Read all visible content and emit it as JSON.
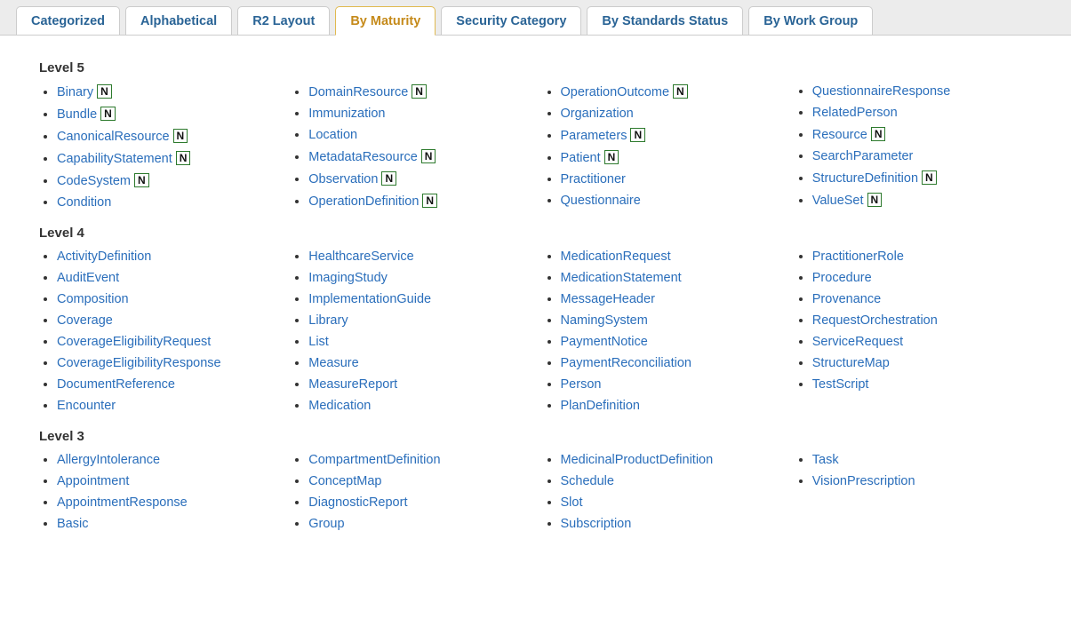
{
  "tabs": [
    {
      "label": "Categorized",
      "active": false
    },
    {
      "label": "Alphabetical",
      "active": false
    },
    {
      "label": "R2 Layout",
      "active": false
    },
    {
      "label": "By Maturity",
      "active": true
    },
    {
      "label": "Security Category",
      "active": false
    },
    {
      "label": "By Standards Status",
      "active": false
    },
    {
      "label": "By Work Group",
      "active": false
    }
  ],
  "n_badge": "N",
  "levels": [
    {
      "heading": "Level 5",
      "columns": [
        [
          {
            "label": "Binary",
            "n": true
          },
          {
            "label": "Bundle",
            "n": true
          },
          {
            "label": "CanonicalResource",
            "n": true
          },
          {
            "label": "CapabilityStatement",
            "n": true
          },
          {
            "label": "CodeSystem",
            "n": true
          },
          {
            "label": "Condition",
            "n": false
          }
        ],
        [
          {
            "label": "DomainResource",
            "n": true
          },
          {
            "label": "Immunization",
            "n": false
          },
          {
            "label": "Location",
            "n": false
          },
          {
            "label": "MetadataResource",
            "n": true
          },
          {
            "label": "Observation",
            "n": true
          },
          {
            "label": "OperationDefinition",
            "n": true
          }
        ],
        [
          {
            "label": "OperationOutcome",
            "n": true
          },
          {
            "label": "Organization",
            "n": false
          },
          {
            "label": "Parameters",
            "n": true
          },
          {
            "label": "Patient",
            "n": true
          },
          {
            "label": "Practitioner",
            "n": false
          },
          {
            "label": "Questionnaire",
            "n": false
          }
        ],
        [
          {
            "label": "QuestionnaireResponse",
            "n": false
          },
          {
            "label": "RelatedPerson",
            "n": false
          },
          {
            "label": "Resource",
            "n": true
          },
          {
            "label": "SearchParameter",
            "n": false
          },
          {
            "label": "StructureDefinition",
            "n": true
          },
          {
            "label": "ValueSet",
            "n": true
          }
        ]
      ]
    },
    {
      "heading": "Level 4",
      "columns": [
        [
          {
            "label": "ActivityDefinition",
            "n": false
          },
          {
            "label": "AuditEvent",
            "n": false
          },
          {
            "label": "Composition",
            "n": false
          },
          {
            "label": "Coverage",
            "n": false
          },
          {
            "label": "CoverageEligibilityRequest",
            "n": false
          },
          {
            "label": "CoverageEligibilityResponse",
            "n": false
          },
          {
            "label": "DocumentReference",
            "n": false
          },
          {
            "label": "Encounter",
            "n": false
          }
        ],
        [
          {
            "label": "HealthcareService",
            "n": false
          },
          {
            "label": "ImagingStudy",
            "n": false
          },
          {
            "label": "ImplementationGuide",
            "n": false
          },
          {
            "label": "Library",
            "n": false
          },
          {
            "label": "List",
            "n": false
          },
          {
            "label": "Measure",
            "n": false
          },
          {
            "label": "MeasureReport",
            "n": false
          },
          {
            "label": "Medication",
            "n": false
          }
        ],
        [
          {
            "label": "MedicationRequest",
            "n": false
          },
          {
            "label": "MedicationStatement",
            "n": false
          },
          {
            "label": "MessageHeader",
            "n": false
          },
          {
            "label": "NamingSystem",
            "n": false
          },
          {
            "label": "PaymentNotice",
            "n": false
          },
          {
            "label": "PaymentReconciliation",
            "n": false
          },
          {
            "label": "Person",
            "n": false
          },
          {
            "label": "PlanDefinition",
            "n": false
          }
        ],
        [
          {
            "label": "PractitionerRole",
            "n": false
          },
          {
            "label": "Procedure",
            "n": false
          },
          {
            "label": "Provenance",
            "n": false
          },
          {
            "label": "RequestOrchestration",
            "n": false
          },
          {
            "label": "ServiceRequest",
            "n": false
          },
          {
            "label": "StructureMap",
            "n": false
          },
          {
            "label": "TestScript",
            "n": false
          }
        ]
      ]
    },
    {
      "heading": "Level 3",
      "columns": [
        [
          {
            "label": "AllergyIntolerance",
            "n": false
          },
          {
            "label": "Appointment",
            "n": false
          },
          {
            "label": "AppointmentResponse",
            "n": false
          },
          {
            "label": "Basic",
            "n": false
          }
        ],
        [
          {
            "label": "CompartmentDefinition",
            "n": false
          },
          {
            "label": "ConceptMap",
            "n": false
          },
          {
            "label": "DiagnosticReport",
            "n": false
          },
          {
            "label": "Group",
            "n": false
          }
        ],
        [
          {
            "label": "MedicinalProductDefinition",
            "n": false
          },
          {
            "label": "Schedule",
            "n": false
          },
          {
            "label": "Slot",
            "n": false
          },
          {
            "label": "Subscription",
            "n": false
          }
        ],
        [
          {
            "label": "Task",
            "n": false
          },
          {
            "label": "VisionPrescription",
            "n": false
          }
        ]
      ]
    }
  ]
}
